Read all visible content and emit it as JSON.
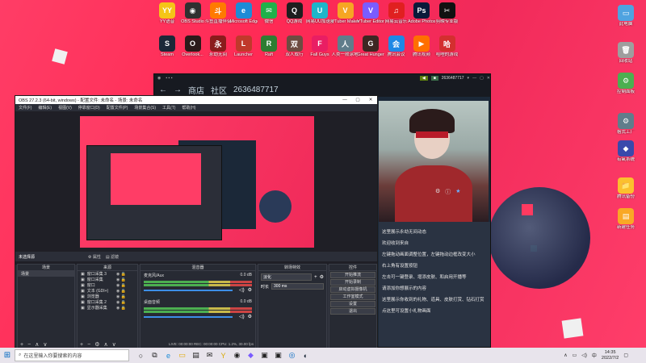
{
  "desktop": {
    "icons_top": [
      {
        "label": "YY语音",
        "color": "#f5c518",
        "glyph": "YY",
        "icon": "yy-icon"
      },
      {
        "label": "OBS Studio",
        "color": "#303030",
        "glyph": "◉",
        "icon": "obs-icon"
      },
      {
        "label": "斗鱼直播伴侣",
        "color": "#ff7a00",
        "glyph": "斗",
        "icon": "douyu-icon"
      },
      {
        "label": "Microsoft Edge",
        "color": "#1d8bd6",
        "glyph": "e",
        "icon": "edge-icon"
      },
      {
        "label": "微信",
        "color": "#20b04a",
        "glyph": "✉",
        "icon": "wechat-icon"
      },
      {
        "label": "QQ游戏",
        "color": "#1e1e1e",
        "glyph": "Q",
        "icon": "qq-icon"
      },
      {
        "label": "网易UU加速器",
        "color": "#1fb5c9",
        "glyph": "U",
        "icon": "uu-icon"
      },
      {
        "label": "VTuber Maker",
        "color": "#f6a623",
        "glyph": "V",
        "icon": "vtuber-maker-icon"
      },
      {
        "label": "VTuber Editor",
        "color": "#7a5cff",
        "glyph": "V",
        "icon": "vtuber-editor-icon"
      },
      {
        "label": "网易云音乐",
        "color": "#e02020",
        "glyph": "♫",
        "icon": "netease-music-icon"
      },
      {
        "label": "Adobe Photosh...",
        "color": "#0a1a3a",
        "glyph": "Ps",
        "icon": "photoshop-icon"
      },
      {
        "label": "剪映专业版",
        "color": "#111111",
        "glyph": "✂",
        "icon": "jianying-icon"
      }
    ],
    "icons_row2": [
      {
        "label": "Steam",
        "color": "#1b2838",
        "glyph": "S",
        "icon": "steam-icon"
      },
      {
        "label": "Overlook...",
        "color": "#2b1a1a",
        "glyph": "O",
        "icon": "overlook-icon"
      },
      {
        "label": "永劫无间",
        "color": "#8a1c1c",
        "glyph": "永",
        "icon": "naraka-icon"
      },
      {
        "label": "Launcher",
        "color": "#c0392b",
        "glyph": "L",
        "icon": "launcher-icon"
      },
      {
        "label": "Raft",
        "color": "#2e7d32",
        "glyph": "R",
        "icon": "raft-icon"
      },
      {
        "label": "双人成行",
        "color": "#6d4c41",
        "glyph": "双",
        "icon": "ittakestwo-icon"
      },
      {
        "label": "Fall Guys",
        "color": "#e91e63",
        "glyph": "F",
        "icon": "fallguys-icon"
      },
      {
        "label": "人类一败涂地 Human Fa...",
        "color": "#607d8b",
        "glyph": "人",
        "icon": "humanfallflat-icon"
      },
      {
        "label": "Great Hunger",
        "color": "#3e2723",
        "glyph": "G",
        "icon": "greathunger-icon"
      },
      {
        "label": "腾讯会议",
        "color": "#1e88e5",
        "glyph": "会",
        "icon": "tencent-meeting-icon"
      },
      {
        "label": "腾讯视频",
        "color": "#ff6f00",
        "glyph": "▶",
        "icon": "tencent-video-icon"
      },
      {
        "label": "哈哩的游戏",
        "color": "#d32f2f",
        "glyph": "哈",
        "icon": "game-icon"
      }
    ],
    "icons_right": [
      {
        "label": "此电脑",
        "color": "#4fa3e0",
        "glyph": "▭",
        "icon": "this-pc-icon"
      },
      {
        "label": "回收站",
        "color": "#9e9e9e",
        "glyph": "🗑",
        "icon": "recycle-bin-icon"
      },
      {
        "label": "控制面板",
        "color": "#4caf50",
        "glyph": "⚙",
        "icon": "control-panel-icon"
      },
      {
        "label": "格式工厂",
        "color": "#607d8b",
        "glyph": "⚙",
        "icon": "format-factory-icon"
      },
      {
        "label": "有氧系统",
        "color": "#3949ab",
        "glyph": "◆",
        "icon": "app-icon"
      },
      {
        "label": "腾讯备份",
        "color": "#fbc02d",
        "glyph": "📁",
        "icon": "folder-icon"
      },
      {
        "label": "新建任务",
        "color": "#f9a825",
        "glyph": "▤",
        "icon": "document-icon"
      }
    ]
  },
  "steam": {
    "nav_items": [
      "商店",
      "社区",
      "2636487717"
    ],
    "username": "2636487717",
    "chat_lines": [
      "这里展示永劫无间动态",
      "欢迎收到来自",
      "左键拖动画面调整位置，左键拖动边框改变大小",
      "右上角有设置按钮",
      "左击可一键登录、增添皮肤、和启用开播等",
      "请添加你想展示的内容",
      "这里展示你收到的礼物、道具、皮肤打赏、钻石打赏",
      "点这里可设置小礼物画面"
    ]
  },
  "obs": {
    "title": "OBS 27.2.3 (64-bit, windows) - 配置文件: 未命名 - 场景: 未命名",
    "menu": [
      "文件(F)",
      "编辑(E)",
      "视图(V)",
      "停靠窗口(D)",
      "配置文件(P)",
      "场景集合(S)",
      "工具(T)",
      "帮助(H)"
    ],
    "no_source": "未选择源",
    "props_btn": "属性",
    "filter_btn": "滤镜",
    "docks": {
      "scenes": "场景",
      "sources": "来源",
      "mixer": "混音器",
      "transitions": "转场特效",
      "controls": "控件"
    },
    "scene_items": [
      "场景"
    ],
    "source_items": [
      "窗口采集 3",
      "窗口采集",
      "窗口",
      "文本 (GDI+)",
      "浏览器",
      "窗口采集 2",
      "显示器采集"
    ],
    "mixer_items": [
      {
        "name": "麦克风/Aux",
        "db": "0.0 dB"
      },
      {
        "name": "桌面音频",
        "db": "0.0 dB"
      }
    ],
    "transition": {
      "type": "淡化",
      "duration_label": "时长",
      "duration": "300 ms"
    },
    "controls": [
      "开始推流",
      "开始录制",
      "启动虚拟摄像机",
      "工作室模式",
      "设置",
      "退出"
    ],
    "status": "LIVE: 00:00:00  REC: 00:00:00  CPU: 1.2%, 30.00 fps"
  },
  "taskbar": {
    "search_placeholder": "在这里输入你要搜索的内容",
    "time": "14:35",
    "date": "2022/7/2",
    "ime": "中",
    "accent": "#0067c0"
  }
}
